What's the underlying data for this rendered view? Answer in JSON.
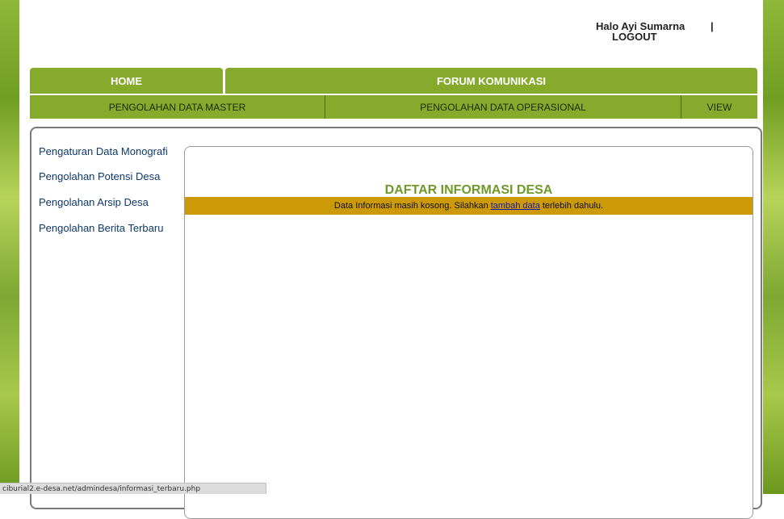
{
  "header": {
    "greeting": "Halo Ayi Sumarna",
    "separator": "|",
    "logout_label": "LOGOUT"
  },
  "nav_primary": {
    "items": [
      {
        "label": "HOME"
      },
      {
        "label": "FORUM KOMUNIKASI"
      }
    ]
  },
  "nav_secondary": {
    "items": [
      {
        "label": "PENGOLAHAN DATA MASTER"
      },
      {
        "label": "PENGOLAHAN DATA OPERASIONAL"
      },
      {
        "label": "VIEW"
      }
    ]
  },
  "sidebar": {
    "items": [
      {
        "label": "Pengaturan Data Monografi"
      },
      {
        "label": "Pengolahan Potensi Desa"
      },
      {
        "label": "Pengolahan Arsip Desa"
      },
      {
        "label": "Pengolahan Berita Terbaru"
      }
    ]
  },
  "main": {
    "title": "DAFTAR INFORMASI DESA",
    "notice_before": "Data Informasi masih kosong. Silahkan",
    "notice_link": "tambah data",
    "notice_after": "terlebih dahulu."
  },
  "statusbar": {
    "url": "ciburial2.e-desa.net/admindesa/informasi_terbaru.php"
  },
  "colors": {
    "nav_green": "#86ab2c",
    "title_green": "#6f9a2a",
    "notice_bar": "#cc9a06",
    "link_blue": "#0e3a6e"
  }
}
